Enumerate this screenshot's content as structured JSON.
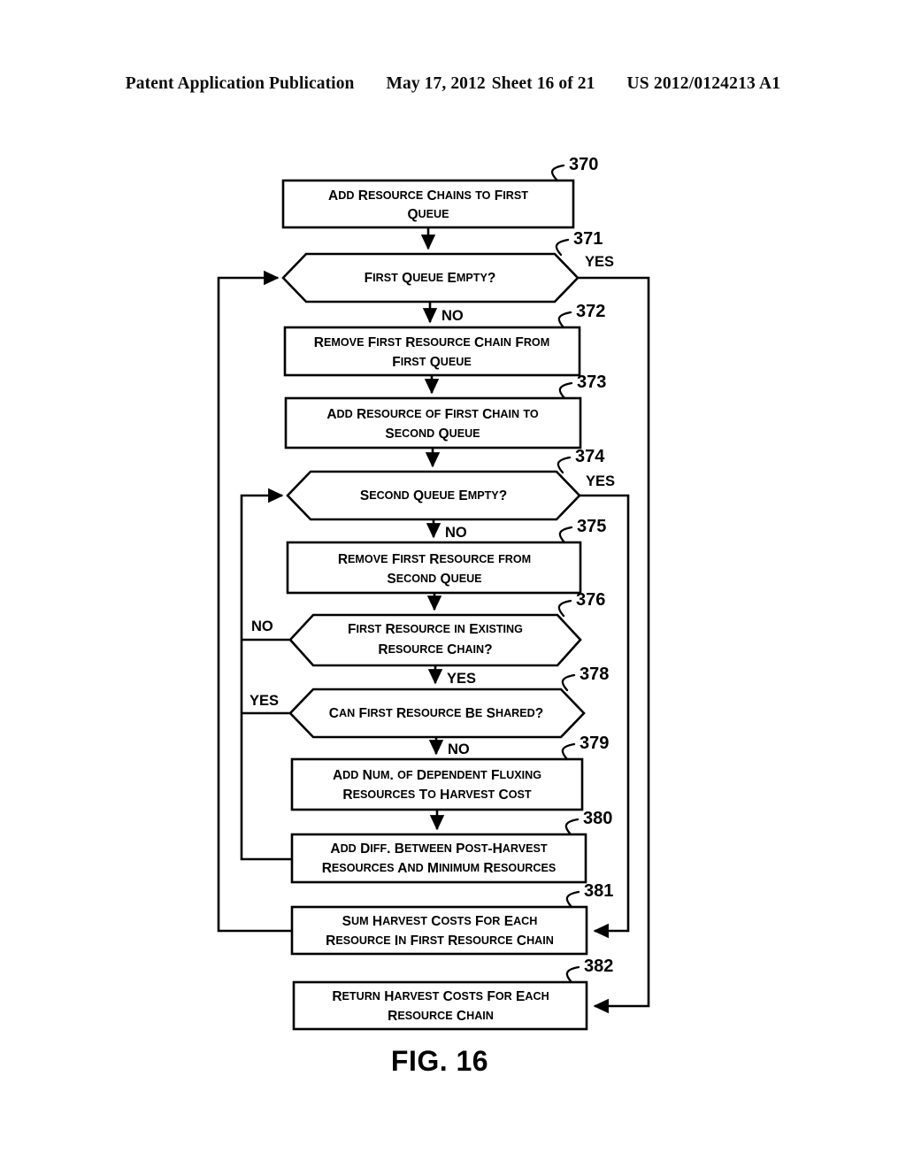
{
  "header": {
    "publication": "Patent Application Publication",
    "date": "May 17, 2012",
    "sheet": "Sheet 16 of 21",
    "doc_number": "US 2012/0124213 A1"
  },
  "figure": {
    "caption": "FIG. 16"
  },
  "chart_data": {
    "type": "diagram",
    "diagram_kind": "flowchart",
    "title": "FIG. 16",
    "nodes": [
      {
        "ref": "370",
        "shape": "process",
        "lines": [
          "Add Resource Chains to First",
          "Queue"
        ]
      },
      {
        "ref": "371",
        "shape": "decision",
        "lines": [
          "First Queue Empty?"
        ]
      },
      {
        "ref": "372",
        "shape": "process",
        "lines": [
          "Remove First Resource Chain From",
          "First Queue"
        ]
      },
      {
        "ref": "373",
        "shape": "process",
        "lines": [
          "Add Resource of First Chain to",
          "Second Queue"
        ]
      },
      {
        "ref": "374",
        "shape": "decision",
        "lines": [
          "Second Queue Empty?"
        ]
      },
      {
        "ref": "375",
        "shape": "process",
        "lines": [
          "Remove First Resource from",
          "Second Queue"
        ]
      },
      {
        "ref": "376",
        "shape": "decision",
        "lines": [
          "First Resource in Existing",
          "Resource Chain?"
        ]
      },
      {
        "ref": "378",
        "shape": "decision",
        "lines": [
          "Can First Resource Be Shared?"
        ]
      },
      {
        "ref": "379",
        "shape": "process",
        "lines": [
          "Add Num. of Dependent Fluxing",
          "Resources To Harvest Cost"
        ]
      },
      {
        "ref": "380",
        "shape": "process",
        "lines": [
          "Add Diff. Between Post-Harvest",
          "Resources And Minimum Resources"
        ]
      },
      {
        "ref": "381",
        "shape": "process",
        "lines": [
          "Sum Harvest Costs For Each",
          "Resource In First Resource Chain"
        ]
      },
      {
        "ref": "382",
        "shape": "process",
        "lines": [
          "Return Harvest Costs For Each",
          "Resource Chain"
        ]
      }
    ],
    "edges": [
      {
        "from": "370",
        "to": "371",
        "label": ""
      },
      {
        "from": "371",
        "to": "382",
        "label": "YES"
      },
      {
        "from": "371",
        "to": "372",
        "label": "NO"
      },
      {
        "from": "372",
        "to": "373",
        "label": ""
      },
      {
        "from": "373",
        "to": "374",
        "label": ""
      },
      {
        "from": "374",
        "to": "381",
        "label": "YES"
      },
      {
        "from": "374",
        "to": "375",
        "label": "NO"
      },
      {
        "from": "375",
        "to": "376",
        "label": ""
      },
      {
        "from": "376",
        "to": "380",
        "label": "NO"
      },
      {
        "from": "376",
        "to": "378",
        "label": "YES"
      },
      {
        "from": "378",
        "to": "380",
        "label": "YES"
      },
      {
        "from": "378",
        "to": "379",
        "label": "NO"
      },
      {
        "from": "379",
        "to": "380",
        "label": ""
      },
      {
        "from": "380",
        "to": "374",
        "label": ""
      },
      {
        "from": "381",
        "to": "371",
        "label": ""
      }
    ]
  },
  "edge_labels": {
    "yes_371": "YES",
    "no_371": "NO",
    "yes_374": "YES",
    "no_374": "NO",
    "no_376": "NO",
    "yes_376": "YES",
    "yes_378": "YES",
    "no_378": "NO"
  },
  "refs": {
    "r370": "370",
    "r371": "371",
    "r372": "372",
    "r373": "373",
    "r374": "374",
    "r375": "375",
    "r376": "376",
    "r378": "378",
    "r379": "379",
    "r380": "380",
    "r381": "381",
    "r382": "382"
  },
  "nodes": {
    "n370": {
      "l1": "Add Resource Chains to First",
      "l2": "Queue"
    },
    "n371": {
      "l1": "First Queue Empty?"
    },
    "n372": {
      "l1": "Remove First Resource Chain From",
      "l2": "First Queue"
    },
    "n373": {
      "l1": "Add Resource of First Chain to",
      "l2": "Second Queue"
    },
    "n374": {
      "l1": "Second Queue Empty?"
    },
    "n375": {
      "l1": "Remove First Resource from",
      "l2": "Second Queue"
    },
    "n376": {
      "l1": "First Resource in Existing",
      "l2": "Resource Chain?"
    },
    "n378": {
      "l1": "Can First Resource Be Shared?"
    },
    "n379": {
      "l1": "Add Num. of Dependent Fluxing",
      "l2": "Resources To Harvest Cost"
    },
    "n380": {
      "l1": "Add Diff. Between Post-Harvest",
      "l2": "Resources And Minimum Resources"
    },
    "n381": {
      "l1": "Sum Harvest Costs For Each",
      "l2": "Resource In First Resource Chain"
    },
    "n382": {
      "l1": "Return Harvest Costs For Each",
      "l2": "Resource Chain"
    }
  },
  "colors": {
    "ink": "#000000",
    "paper": "#ffffff"
  }
}
